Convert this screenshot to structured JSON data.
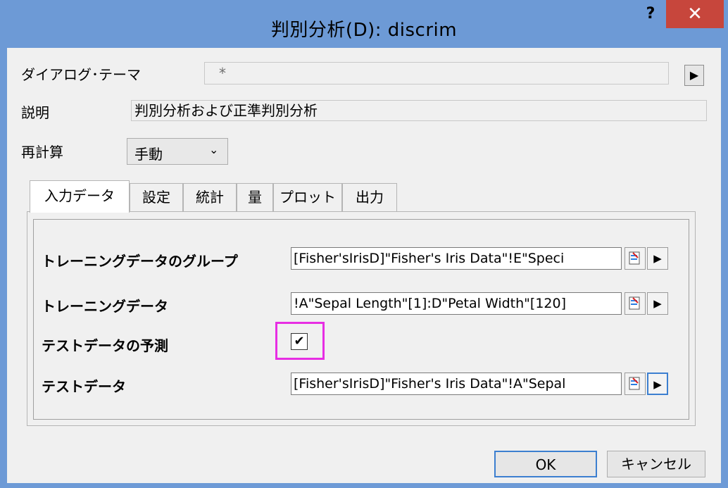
{
  "window": {
    "title": "判別分析(D): discrim",
    "help_label": "?",
    "close_label": "✕"
  },
  "header": {
    "theme_label": "ダイアログ･テーマ",
    "theme_value": "*",
    "description_label": "説明",
    "description_value": "判別分析および正準判別分析",
    "recalc_label": "再計算",
    "recalc_value": "手動",
    "arrow_icon": "▶"
  },
  "tabs": [
    {
      "label": "入力データ",
      "active": true
    },
    {
      "label": "設定"
    },
    {
      "label": "統計"
    },
    {
      "label": "量"
    },
    {
      "label": "プロット"
    },
    {
      "label": "出力"
    }
  ],
  "panel": {
    "training_group_label": "トレーニングデータのグループ",
    "training_group_value": "[Fisher'sIrisD]\"Fisher's Iris Data\"!E\"Speci",
    "training_data_label": "トレーニングデータ",
    "training_data_value": "!A\"Sepal Length\"[1]:D\"Petal Width\"[120]",
    "predict_label": "テストデータの予測",
    "predict_checked": "✔",
    "test_data_label": "テストデータ",
    "test_data_value": "[Fisher'sIrisD]\"Fisher's Iris Data\"!A\"Sepal"
  },
  "buttons": {
    "ok": "OK",
    "cancel": "キャンセル"
  },
  "colors": {
    "frame": "#6d9ad6",
    "close": "#c7463c",
    "highlight": "#e72ee3"
  }
}
